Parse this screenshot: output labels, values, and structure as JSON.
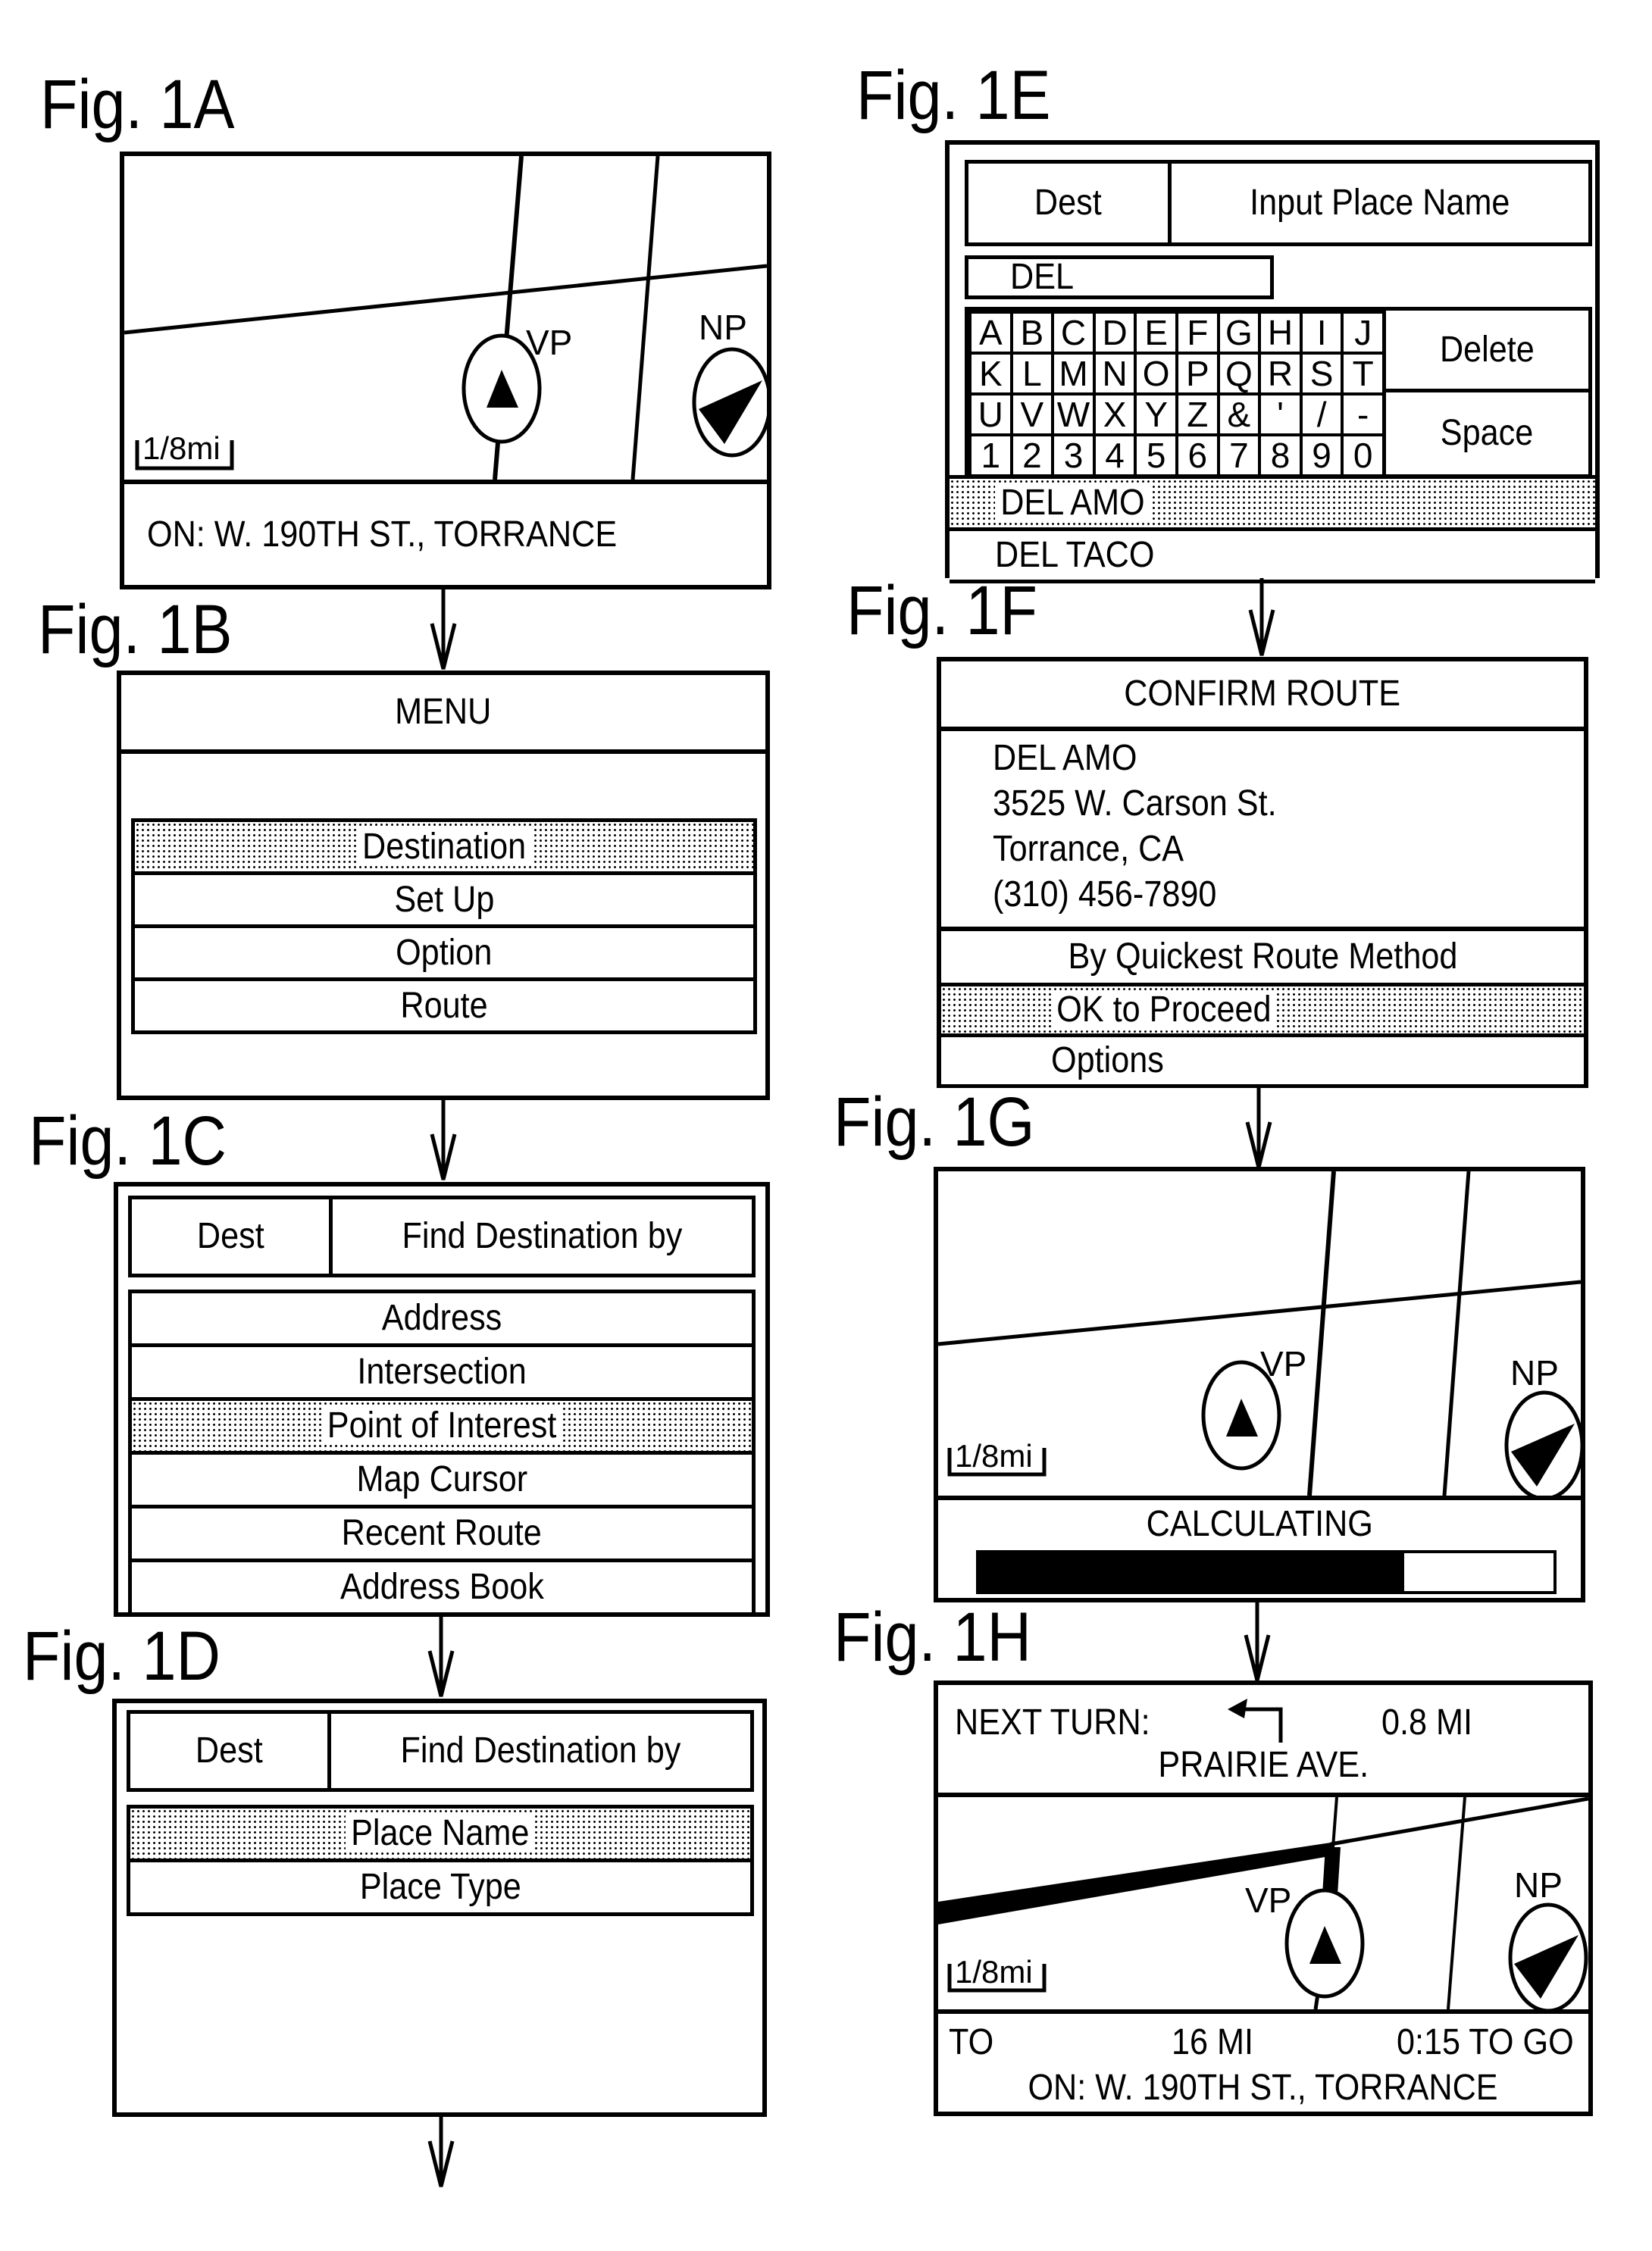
{
  "figures": {
    "a": {
      "label": "Fig. 1A",
      "map": {
        "vehicle_label": "VP",
        "north_label": "NP",
        "scale": "1/8mi"
      },
      "status": "ON:  W. 190TH ST., TORRANCE"
    },
    "b": {
      "label": "Fig. 1B",
      "title": "MENU",
      "items": [
        {
          "label": "Destination",
          "selected": true
        },
        {
          "label": "Set Up",
          "selected": false
        },
        {
          "label": "Option",
          "selected": false
        },
        {
          "label": "Route",
          "selected": false
        }
      ]
    },
    "c": {
      "label": "Fig. 1C",
      "header_left": "Dest",
      "header_right": "Find Destination by",
      "items": [
        {
          "label": "Address",
          "selected": false
        },
        {
          "label": "Intersection",
          "selected": false
        },
        {
          "label": "Point of Interest",
          "selected": true
        },
        {
          "label": "Map Cursor",
          "selected": false
        },
        {
          "label": "Recent Route",
          "selected": false
        },
        {
          "label": "Address Book",
          "selected": false
        }
      ]
    },
    "d": {
      "label": "Fig. 1D",
      "header_left": "Dest",
      "header_right": "Find Destination by",
      "items": [
        {
          "label": "Place Name",
          "selected": true
        },
        {
          "label": "Place Type",
          "selected": false
        }
      ]
    },
    "e": {
      "label": "Fig. 1E",
      "header_left": "Dest",
      "header_right": "Input Place Name",
      "input_value": "DEL",
      "keys": [
        [
          "A",
          "B",
          "C",
          "D",
          "E",
          "F",
          "G",
          "H",
          "I",
          "J"
        ],
        [
          "K",
          "L",
          "M",
          "N",
          "O",
          "P",
          "Q",
          "R",
          "S",
          "T"
        ],
        [
          "U",
          "V",
          "W",
          "X",
          "Y",
          "Z",
          "&",
          "'",
          "/",
          "-"
        ],
        [
          "1",
          "2",
          "3",
          "4",
          "5",
          "6",
          "7",
          "8",
          "9",
          "0"
        ]
      ],
      "delete_label": "Delete",
      "space_label": "Space",
      "results": [
        {
          "label": "DEL AMO",
          "selected": true
        },
        {
          "label": "DEL TACO",
          "selected": false
        }
      ]
    },
    "f": {
      "label": "Fig. 1F",
      "title": "CONFIRM ROUTE",
      "address_lines": [
        "DEL AMO",
        "3525 W. Carson St.",
        "Torrance, CA",
        "(310) 456-7890"
      ],
      "method": "By Quickest Route Method",
      "items": [
        {
          "label": "OK to Proceed",
          "selected": true
        },
        {
          "label": "Options",
          "selected": false
        }
      ]
    },
    "g": {
      "label": "Fig. 1G",
      "map": {
        "vehicle_label": "VP",
        "north_label": "NP",
        "scale": "1/8mi"
      },
      "status": "CALCULATING",
      "progress_percent": 74
    },
    "h": {
      "label": "Fig. 1H",
      "next_turn_label": "NEXT TURN:",
      "turn_icon": "turn-left-arrow",
      "turn_distance": "0.8 MI",
      "turn_street": "PRAIRIE AVE.",
      "map": {
        "vehicle_label": "VP",
        "north_label": "NP",
        "scale": "1/8mi"
      },
      "to_label": "TO",
      "remaining_distance": "16 MI",
      "remaining_time": "0:15 TO GO",
      "status": "ON:  W. 190TH ST., TORRANCE"
    }
  }
}
